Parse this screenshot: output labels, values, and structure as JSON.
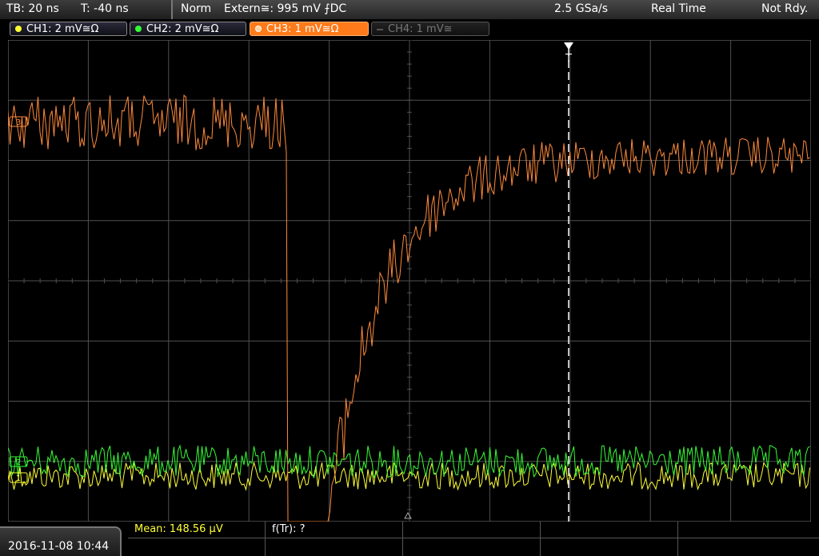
{
  "status_bar": {
    "timebase": "TB: 20 ns",
    "trigger_offset": "T: -40 ns",
    "mode": "Norm",
    "trigger_source": "Extern≅: 995 mV ⨍DC",
    "sample_rate": "2.5 GSa/s",
    "acquisition": "Real Time",
    "state": "Not Rdy."
  },
  "channels": [
    {
      "label": "CH1: 2 mV≅Ω",
      "color": "#ffff33",
      "active": false,
      "enabled": true
    },
    {
      "label": "CH2: 2 mV≅Ω",
      "color": "#33ff33",
      "active": false,
      "enabled": true
    },
    {
      "label": "CH3: 1 mV≅Ω",
      "color": "#ff8030",
      "active": true,
      "enabled": true
    },
    {
      "label": "CH4: 1 mV≅",
      "color": "#777777",
      "active": false,
      "enabled": false
    }
  ],
  "markers": {
    "trigger_label": "T",
    "ch3_marker": "3",
    "ch2_marker": "2",
    "ch1_marker": "1"
  },
  "footer": {
    "datetime": "2016-11-08 10:44",
    "measure_mean": "Mean: 148.56 µV",
    "measure_ftr": "f(Tr): ?"
  },
  "colors": {
    "ch1": "#ffff33",
    "ch2": "#33ff33",
    "ch3": "#ff8a3a",
    "grid": "#505050"
  }
}
